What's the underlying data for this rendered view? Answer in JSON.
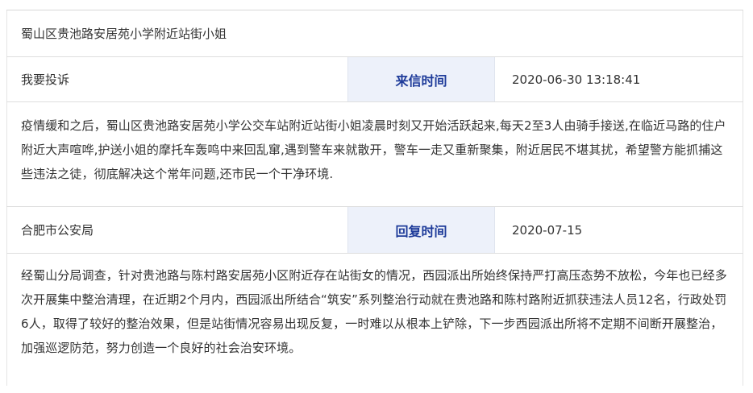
{
  "title": "蜀山区贵池路安居苑小学附近站街小姐",
  "complaint": {
    "category": "我要投诉",
    "time_label": "来信时间",
    "time_value": "2020-06-30 13:18:41",
    "content": "疫情缓和之后，蜀山区贵池路安居苑小学公交车站附近站街小姐凌晨时刻又开始活跃起来,每天2至3人由骑手接送,在临近马路的住户附近大声喧哗,护送小姐的摩托车轰鸣中来回乱窜,遇到警车来就散开，警车一走又重新聚集，附近居民不堪其扰，希望警方能抓捕这些违法之徒，彻底解决这个常年问题,还市民一个干净环境."
  },
  "reply": {
    "department": "合肥市公安局",
    "time_label": "回复时间",
    "time_value": "2020-07-15",
    "content": "经蜀山分局调查，针对贵池路与陈村路安居苑小区附近存在站街女的情况，西园派出所始终保持严打高压态势不放松，今年也已经多次开展集中整治清理，在近期2个月内，西园派出所结合“筑安”系列整治行动就在贵池路和陈村路附近抓获违法人员12名，行政处罚6人，取得了较好的整治效果，但是站街情况容易出现反复，一时难以从根本上铲除，下一步西园派出所将不定期不间断开展整治，加强巡逻防范，努力创造一个良好的社会治安环境。"
  }
}
